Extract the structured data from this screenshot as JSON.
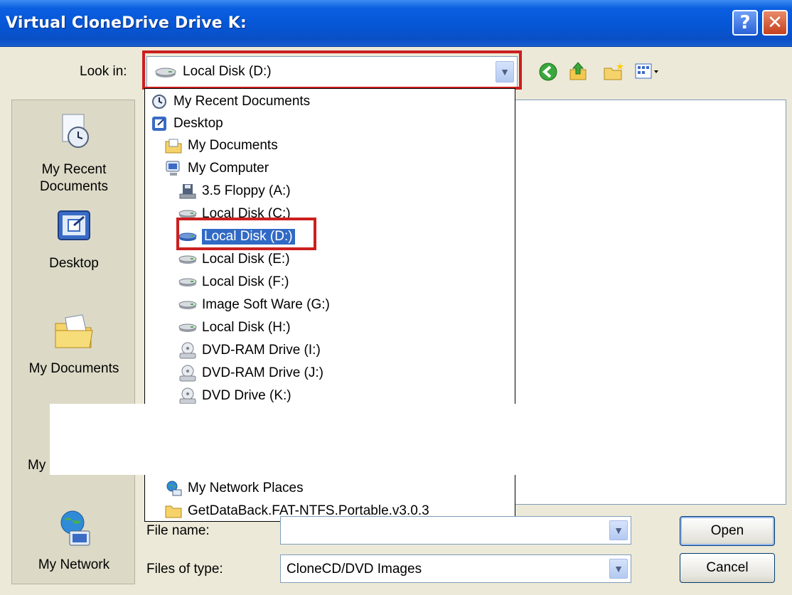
{
  "window": {
    "title": "Virtual CloneDrive Drive K:",
    "help_glyph": "?",
    "close_glyph": "✕"
  },
  "toolbar": {
    "lookin_label": "Look in:",
    "lookin_value": "Local Disk (D:)"
  },
  "places": [
    {
      "label": "My Recent\nDocuments",
      "icon": "recent-documents-icon"
    },
    {
      "label": "Desktop",
      "icon": "desktop-icon"
    },
    {
      "label": "My Documents",
      "icon": "my-documents-icon"
    },
    {
      "label": "My",
      "icon": "my-computer-icon"
    },
    {
      "label": "My Network",
      "icon": "network-icon"
    }
  ],
  "dropdown": {
    "items": [
      {
        "label": "My Recent Documents",
        "icon": "recent-documents-icon"
      },
      {
        "label": "Desktop",
        "icon": "desktop-icon"
      },
      {
        "label": "My Documents",
        "icon": "folder-documents-icon"
      },
      {
        "label": "My Computer",
        "icon": "computer-icon"
      },
      {
        "label": "3.5 Floppy (A:)",
        "icon": "floppy-icon"
      },
      {
        "label": "Local Disk (C:)",
        "icon": "disk-icon"
      },
      {
        "label": "Local Disk (D:)",
        "icon": "disk-icon",
        "selected": true
      },
      {
        "label": "Local Disk (E:)",
        "icon": "disk-icon"
      },
      {
        "label": "Local Disk (F:)",
        "icon": "disk-icon"
      },
      {
        "label": "Image Soft Ware (G:)",
        "icon": "disk-icon"
      },
      {
        "label": "Local Disk (H:)",
        "icon": "disk-icon"
      },
      {
        "label": "DVD-RAM Drive (I:)",
        "icon": "dvd-icon"
      },
      {
        "label": "DVD-RAM Drive (J:)",
        "icon": "dvd-icon"
      },
      {
        "label": "DVD Drive (K:)",
        "icon": "dvd-icon"
      },
      {
        "label": "My Network Places",
        "icon": "network-icon"
      },
      {
        "label": "GetDataBack.FAT-NTFS.Portable.v3.0.3",
        "icon": "folder-icon"
      }
    ]
  },
  "form": {
    "filename_label": "File name:",
    "filename_value": "",
    "filetype_label": "Files of type:",
    "filetype_value": "CloneCD/DVD Images",
    "open_label": "Open",
    "cancel_label": "Cancel"
  },
  "colors": {
    "titlebar": "#0656d6",
    "selection": "#316ac5",
    "highlight_box": "#cc1f1f",
    "dialog_bg": "#ece9d8"
  }
}
